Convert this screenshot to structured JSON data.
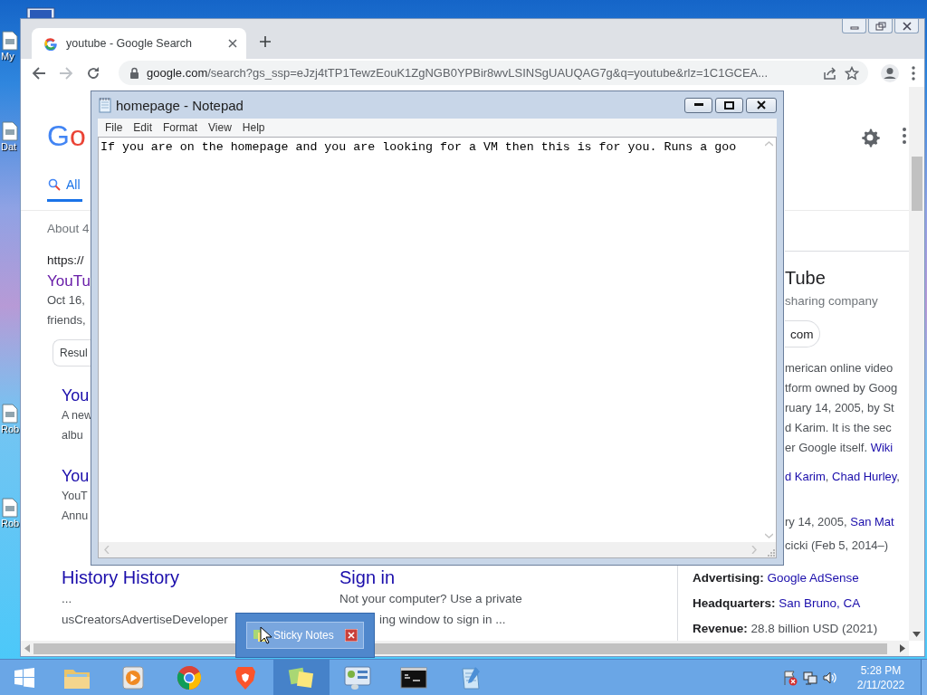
{
  "desktop_icons": [
    {
      "label": "My"
    },
    {
      "label": "Dat"
    },
    {
      "label": "Rob"
    },
    {
      "label": "Rob"
    }
  ],
  "browser": {
    "tab_title": "youtube - Google Search",
    "address": {
      "host": "google.com",
      "path": "/search?gs_ssp=eJzj4tTP1TewzEouK1ZgNGB0YPBir8wvLSINSgUAUQAG7g&q=youtube&rlz=1C1GCEA..."
    },
    "page": {
      "logo": "Go",
      "tabs": [
        {
          "label": "All",
          "selected": true
        }
      ],
      "result_stats": "About 4",
      "result": {
        "url": "https://",
        "title": "YouTu",
        "snippet": [
          "Oct 16,",
          "friends,"
        ],
        "chip": "Resul",
        "sitelinks": [
          {
            "title": "You",
            "lines": [
              "A new",
              "albu"
            ]
          },
          {
            "title": "You",
            "lines": [
              "YouT",
              "Annu"
            ]
          }
        ]
      },
      "more_results": [
        {
          "title": "History History",
          "lines": [
            "...",
            "usCreatorsAdvertiseDeveloper"
          ]
        },
        {
          "title": "Sign in",
          "lines": [
            "Not your computer? Use a private",
            "ing window to sign in ..."
          ]
        }
      ],
      "knowledge_panel": {
        "title": "Tube",
        "subtitle": "sharing company",
        "chip": "com",
        "description": [
          [
            {
              "kind": "text",
              "text": "merican online video"
            }
          ],
          [
            {
              "kind": "text",
              "text": "tform owned by Goog"
            }
          ],
          [
            {
              "kind": "text",
              "text": "ruary 14, 2005, by St"
            }
          ],
          [
            {
              "kind": "text",
              "text": "d Karim. It is the sec"
            }
          ],
          [
            {
              "kind": "text",
              "text": "er Google itself. "
            },
            {
              "kind": "link",
              "text": "Wiki"
            }
          ]
        ],
        "facts": [
          [
            {
              "kind": "link",
              "text": "d Karim"
            },
            {
              "kind": "text",
              "text": ", "
            },
            {
              "kind": "link",
              "text": "Chad Hurley"
            },
            {
              "kind": "text",
              "text": ","
            }
          ],
          [
            {
              "kind": "text",
              "text": "ry 14, 2005, "
            },
            {
              "kind": "link",
              "text": "San Mat"
            }
          ],
          [
            {
              "kind": "text",
              "text": "cicki (Feb 5, 2014–)"
            }
          ]
        ],
        "labeled_facts": [
          {
            "label": "Advertising:",
            "value": "Google AdSense",
            "kind": "link"
          },
          {
            "label": "Headquarters:",
            "value": "San Bruno, CA",
            "kind": "link"
          },
          {
            "label": "Revenue:",
            "value": "28.8 billion USD (2021)",
            "kind": "text"
          }
        ]
      }
    }
  },
  "notepad": {
    "title": "homepage - Notepad",
    "menu": [
      "File",
      "Edit",
      "Format",
      "View",
      "Help"
    ],
    "text": "If you are on the homepage and you are looking for a VM then this is for you. Runs a goo"
  },
  "sticky_preview": {
    "title": "Sticky Notes"
  },
  "taskbar": {
    "apps": [
      {
        "kind": "explorer",
        "selected": false
      },
      {
        "kind": "media",
        "selected": false
      },
      {
        "kind": "chrome",
        "selected": false
      },
      {
        "kind": "brave",
        "selected": false
      },
      {
        "kind": "sticky",
        "selected": true
      },
      {
        "kind": "control",
        "selected": false
      },
      {
        "kind": "terminal",
        "selected": false
      },
      {
        "kind": "notepad",
        "selected": false
      }
    ],
    "time": "5:28 PM",
    "date": "2/11/2022"
  }
}
